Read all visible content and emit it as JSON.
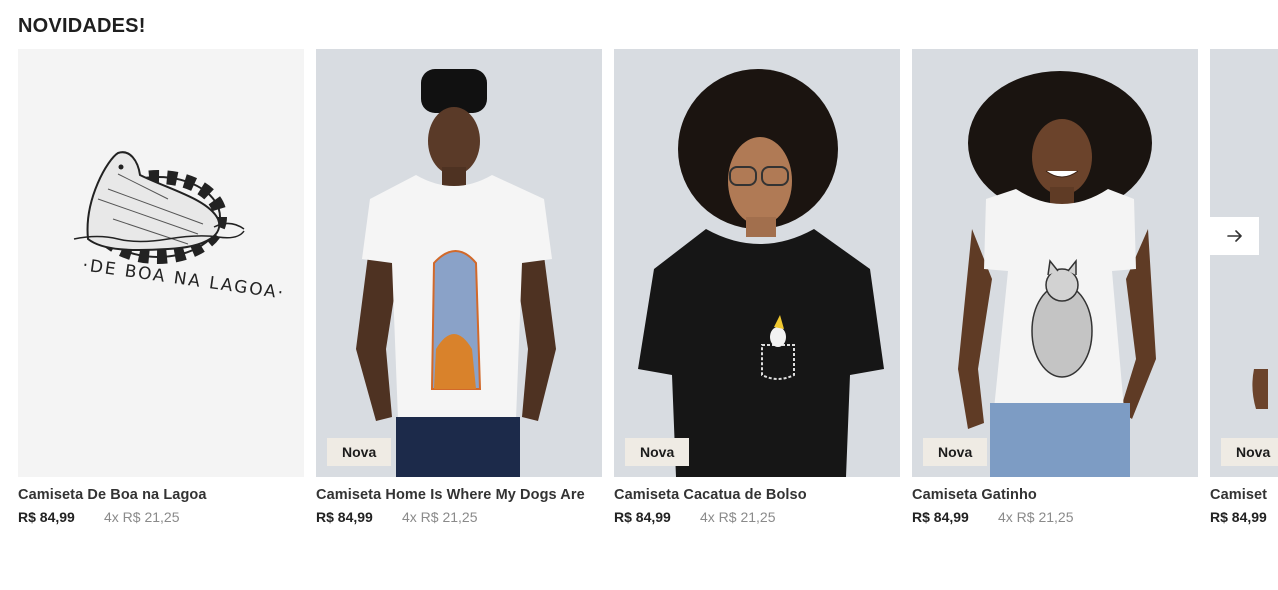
{
  "section": {
    "title": "NOVIDADES!"
  },
  "products": [
    {
      "name": "Camiseta De Boa na Lagoa",
      "badge": "",
      "price": "R$ 84,99",
      "installments": "4x R$ 21,25",
      "artwork_text": "·DE BOA NA LAGOA·"
    },
    {
      "name": "Camiseta Home Is Where My Dogs Are",
      "badge": "Nova",
      "price": "R$ 84,99",
      "installments": "4x R$ 21,25"
    },
    {
      "name": "Camiseta Cacatua de Bolso",
      "badge": "Nova",
      "price": "R$ 84,99",
      "installments": "4x R$ 21,25"
    },
    {
      "name": "Camiseta Gatinho",
      "badge": "Nova",
      "price": "R$ 84,99",
      "installments": "4x R$ 21,25"
    },
    {
      "name": "Camiset",
      "badge": "Nova",
      "price": "R$ 84,99",
      "installments": ""
    }
  ],
  "carousel": {
    "next_icon": "arrow-right-icon"
  },
  "colors": {
    "photo_bg": "#d9dde2",
    "badge_bg": "#efebe4",
    "price_text": "#222222",
    "installment_text": "#8a8a8a"
  }
}
